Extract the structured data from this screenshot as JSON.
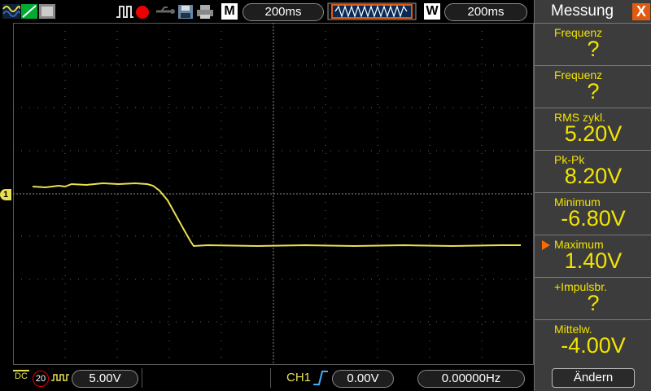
{
  "top_bar": {
    "mode_badge": "M",
    "timebase": "200ms",
    "window_badge": "W",
    "window_timebase": "200ms"
  },
  "sidebar": {
    "title": "Messung",
    "close_label": "X",
    "measurements": [
      {
        "label": "Frequenz",
        "value": "?",
        "selected": false
      },
      {
        "label": "Frequenz",
        "value": "?",
        "selected": false
      },
      {
        "label": "RMS  zykl.",
        "value": "5.20V",
        "selected": false
      },
      {
        "label": "Pk-Pk",
        "value": "8.20V",
        "selected": false
      },
      {
        "label": "Minimum",
        "value": "-6.80V",
        "selected": false
      },
      {
        "label": "Maximum",
        "value": "1.40V",
        "selected": true
      },
      {
        "label": "+Impulsbr.",
        "value": "?",
        "selected": false
      },
      {
        "label": "Mittelw.",
        "value": "-4.00V",
        "selected": false
      }
    ],
    "button_label": "Ändern"
  },
  "bottom_bar": {
    "coupling": "DC",
    "bw_limit": "20",
    "volts_div": "5.00V",
    "trigger_source": "CH1",
    "trigger_level": "0.00V",
    "frequency": "0.00000Hz"
  },
  "channel_marker": "1",
  "colors": {
    "trace": "#e8e050",
    "accent": "#e05a10",
    "label": "#f2e300"
  }
}
